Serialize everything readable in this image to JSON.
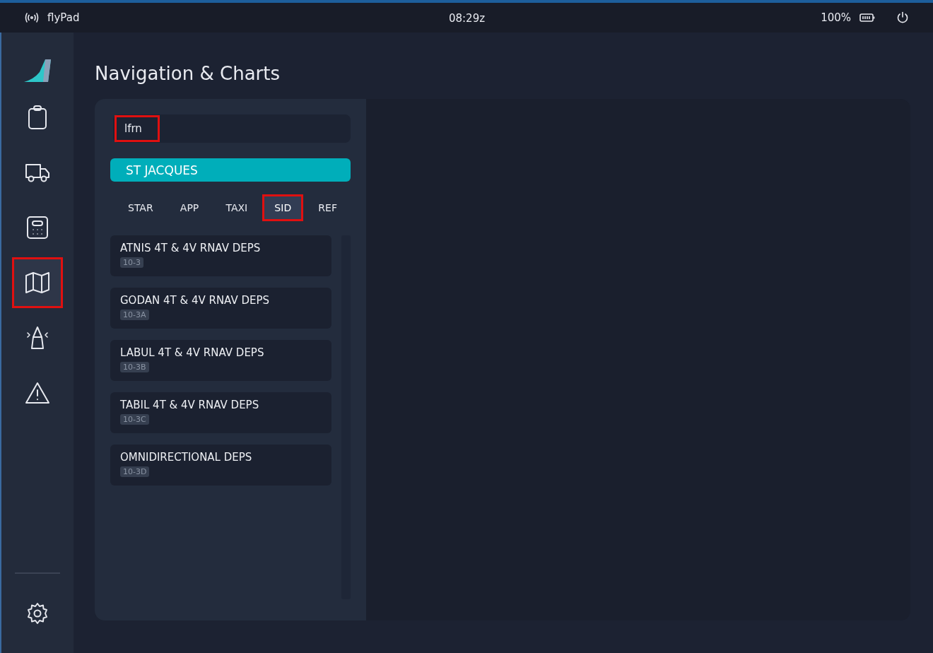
{
  "status_bar": {
    "app_name": "flyPad",
    "time": "08:29z",
    "battery": "100%"
  },
  "sidebar": {
    "items": [
      {
        "kind": "clipboard",
        "selected": false,
        "highlighted": false
      },
      {
        "kind": "truck",
        "selected": false,
        "highlighted": false
      },
      {
        "kind": "calculator",
        "selected": false,
        "highlighted": false
      },
      {
        "kind": "map",
        "selected": true,
        "highlighted": true
      },
      {
        "kind": "tower",
        "selected": false,
        "highlighted": false
      },
      {
        "kind": "warning",
        "selected": false,
        "highlighted": false
      }
    ]
  },
  "page": {
    "title": "Navigation & Charts"
  },
  "search": {
    "value": "lfrn",
    "highlighted": true
  },
  "airport": {
    "name": "ST JACQUES"
  },
  "tabs": [
    {
      "label": "STAR",
      "selected": false,
      "highlighted": false
    },
    {
      "label": "APP",
      "selected": false,
      "highlighted": false
    },
    {
      "label": "TAXI",
      "selected": false,
      "highlighted": false
    },
    {
      "label": "SID",
      "selected": true,
      "highlighted": true
    },
    {
      "label": "REF",
      "selected": false,
      "highlighted": false
    }
  ],
  "charts": [
    {
      "name": "ATNIS 4T & 4V RNAV DEPS",
      "code": "10-3"
    },
    {
      "name": "GODAN 4T & 4V RNAV DEPS",
      "code": "10-3A"
    },
    {
      "name": "LABUL 4T & 4V RNAV DEPS",
      "code": "10-3B"
    },
    {
      "name": "TABIL 4T & 4V RNAV DEPS",
      "code": "10-3C"
    },
    {
      "name": "OMNIDIRECTIONAL DEPS",
      "code": "10-3D"
    }
  ]
}
